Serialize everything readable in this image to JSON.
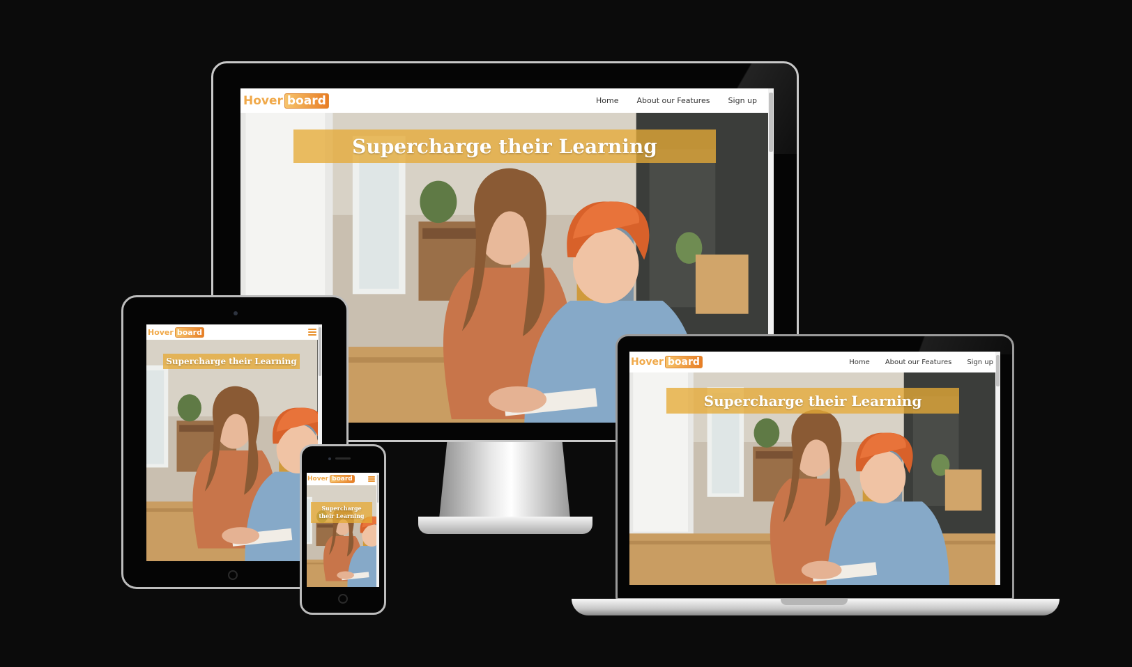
{
  "site": {
    "logo": {
      "part1": "Hover",
      "part2": "board"
    },
    "nav": {
      "home": "Home",
      "features": "About our Features",
      "signup": "Sign up"
    },
    "hero_title": "Supercharge their Learning",
    "hero_title_phone": {
      "line1": "Supercharge",
      "line2": "their Learning"
    }
  },
  "icons": {
    "menu": "hamburger-menu-icon",
    "home_button": "home-button-icon",
    "camera": "camera-icon"
  },
  "colors": {
    "background": "#0b0b0b",
    "accent": "#e8902b",
    "banner": "#e6aa37",
    "logo_text": "#f0a94a"
  }
}
